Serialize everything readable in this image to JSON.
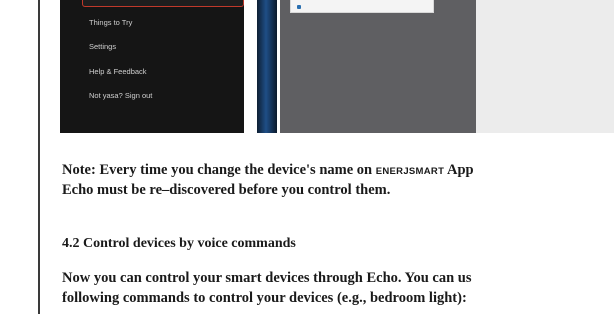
{
  "app_menu": {
    "items": [
      {
        "label": "Things to Try"
      },
      {
        "label": "Settings"
      },
      {
        "label": "Help & Feedback"
      },
      {
        "label": "Not yasa? Sign out"
      }
    ]
  },
  "note": {
    "prefix": "Note: Every time you change the device's name on ",
    "app_name": "ENERJSMART",
    "suffix": " App",
    "line2": "Echo must be re–discovered before you control them."
  },
  "section": {
    "heading": "4.2 Control devices by voice commands",
    "line1": "Now you can control your smart devices through Echo. You can us",
    "line2": "following commands to control your devices (e.g., bedroom light):"
  }
}
